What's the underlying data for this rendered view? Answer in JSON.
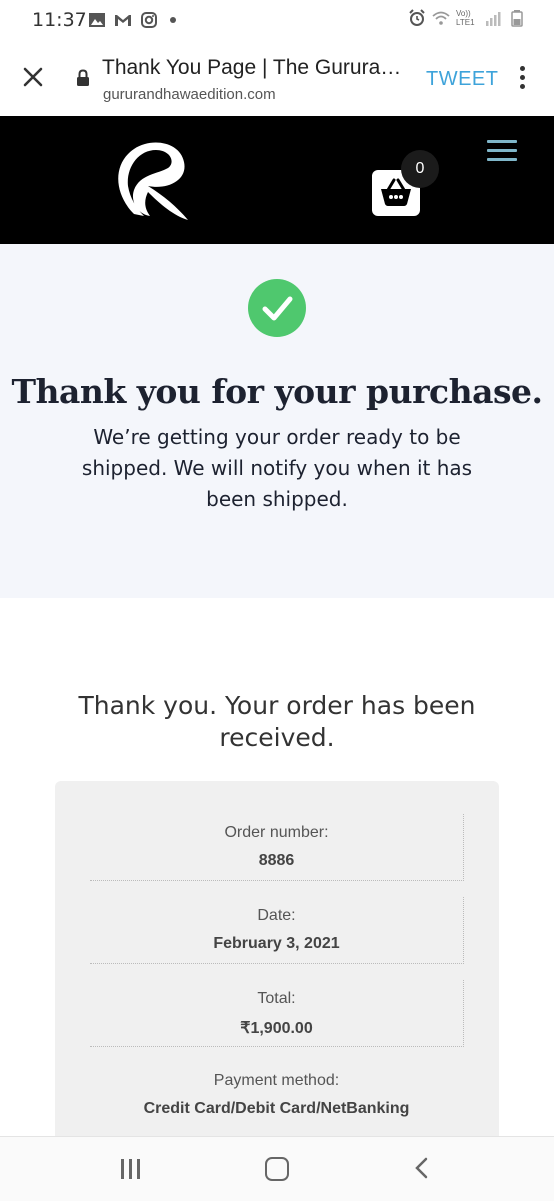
{
  "status_bar": {
    "time": "11:37",
    "left_icons": [
      "image-icon",
      "gmail-icon",
      "instagram-icon",
      "dot-icon"
    ],
    "right_icons": [
      "alarm-icon",
      "wifi-icon",
      "lte-icon",
      "signal-icon",
      "battery-icon"
    ],
    "lte_label": "Vo)) LTE1"
  },
  "browser": {
    "page_title": "Thank You Page | The Gururan...",
    "url": "gururandhawaedition.com",
    "action_label": "TWEET",
    "accent_color": "#3ea3da"
  },
  "header": {
    "cart_count": "0",
    "menu_color": "#7fb6c9"
  },
  "hero": {
    "heading": "Thank you for your purchase.",
    "subtext": "We’re getting your order ready to be shipped. We will notify you when it has been shipped.",
    "check_color": "#4fc86e"
  },
  "order": {
    "title": "Thank you. Your order has been received.",
    "details": [
      {
        "label": "Order number:",
        "value": "8886"
      },
      {
        "label": "Date:",
        "value": "February 3, 2021"
      },
      {
        "label": "Total:",
        "value": "₹1,900.00"
      },
      {
        "label": "Payment method:",
        "value": "Credit Card/Debit Card/NetBanking"
      }
    ]
  }
}
